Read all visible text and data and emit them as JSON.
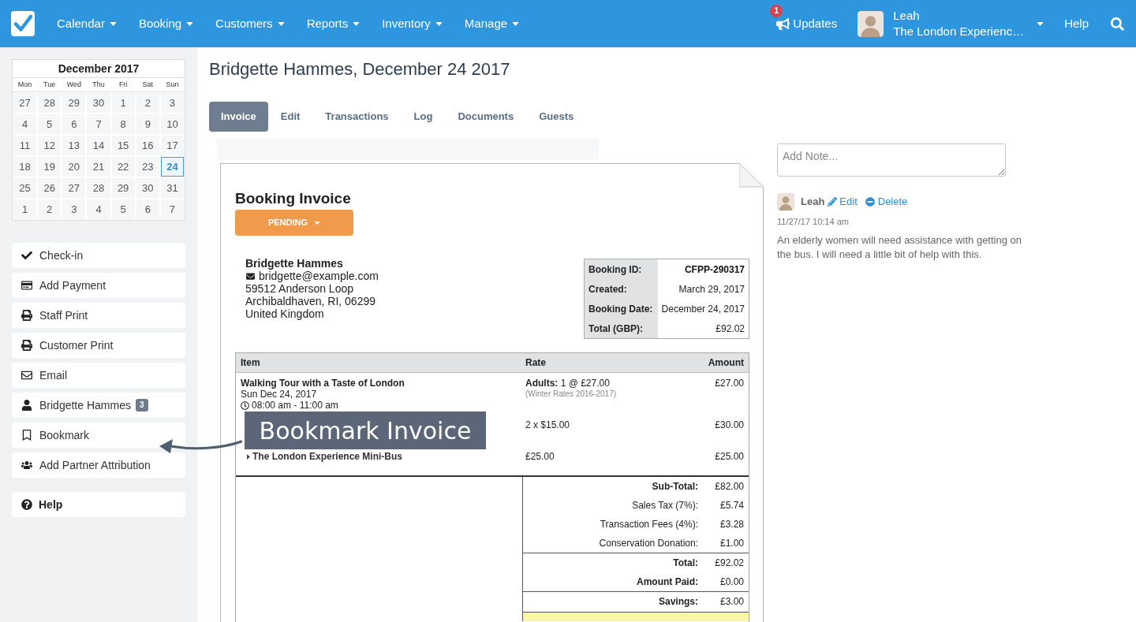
{
  "nav": {
    "items": [
      {
        "label": "Calendar"
      },
      {
        "label": "Booking"
      },
      {
        "label": "Customers"
      },
      {
        "label": "Reports"
      },
      {
        "label": "Inventory"
      },
      {
        "label": "Manage"
      }
    ],
    "updates": {
      "label": "Updates",
      "badge": "1"
    },
    "user": {
      "name": "Leah",
      "company": "The London Experienc…"
    },
    "help": "Help"
  },
  "sidebar": {
    "calendar": {
      "title": "December 2017",
      "weekdays": [
        "Mon",
        "Tue",
        "Wed",
        "Thu",
        "Fri",
        "Sat",
        "Sun"
      ],
      "weeks": [
        [
          {
            "day": "27",
            "selected": false
          },
          {
            "day": "28",
            "selected": false
          },
          {
            "day": "29",
            "selected": false
          },
          {
            "day": "30",
            "selected": false
          },
          {
            "day": "1",
            "selected": false
          },
          {
            "day": "2",
            "selected": false
          },
          {
            "day": "3",
            "selected": false
          }
        ],
        [
          {
            "day": "4",
            "selected": false
          },
          {
            "day": "5",
            "selected": false
          },
          {
            "day": "6",
            "selected": false
          },
          {
            "day": "7",
            "selected": false
          },
          {
            "day": "8",
            "selected": false
          },
          {
            "day": "9",
            "selected": false
          },
          {
            "day": "10",
            "selected": false
          }
        ],
        [
          {
            "day": "11",
            "selected": false
          },
          {
            "day": "12",
            "selected": false
          },
          {
            "day": "13",
            "selected": false
          },
          {
            "day": "14",
            "selected": false
          },
          {
            "day": "15",
            "selected": false
          },
          {
            "day": "16",
            "selected": false
          },
          {
            "day": "17",
            "selected": false
          }
        ],
        [
          {
            "day": "18",
            "selected": false
          },
          {
            "day": "19",
            "selected": false
          },
          {
            "day": "20",
            "selected": false
          },
          {
            "day": "21",
            "selected": false
          },
          {
            "day": "22",
            "selected": false
          },
          {
            "day": "23",
            "selected": false
          },
          {
            "day": "24",
            "selected": true
          }
        ],
        [
          {
            "day": "25",
            "selected": false
          },
          {
            "day": "26",
            "selected": false
          },
          {
            "day": "27",
            "selected": false
          },
          {
            "day": "28",
            "selected": false
          },
          {
            "day": "29",
            "selected": false
          },
          {
            "day": "30",
            "selected": false
          },
          {
            "day": "31",
            "selected": false
          }
        ],
        [
          {
            "day": "1",
            "selected": false
          },
          {
            "day": "2",
            "selected": false
          },
          {
            "day": "3",
            "selected": false
          },
          {
            "day": "4",
            "selected": false
          },
          {
            "day": "5",
            "selected": false
          },
          {
            "day": "6",
            "selected": false
          },
          {
            "day": "7",
            "selected": false
          }
        ]
      ]
    },
    "actions": [
      {
        "label": "Check-in"
      },
      {
        "label": "Add Payment"
      },
      {
        "label": "Staff Print"
      },
      {
        "label": "Customer Print"
      },
      {
        "label": "Email"
      },
      {
        "label": "Bridgette Hammes",
        "badge": "3"
      },
      {
        "label": "Bookmark"
      },
      {
        "label": "Add Partner Attribution"
      }
    ],
    "help": "Help"
  },
  "main": {
    "page_title": "Bridgette Hammes, December 24 2017",
    "tabs": [
      {
        "label": "Invoice",
        "selected": true
      },
      {
        "label": "Edit",
        "selected": false
      },
      {
        "label": "Transactions",
        "selected": false
      },
      {
        "label": "Log",
        "selected": false
      },
      {
        "label": "Documents",
        "selected": false
      },
      {
        "label": "Guests",
        "selected": false
      }
    ],
    "invoice": {
      "title": "Booking Invoice",
      "status": "PENDING",
      "customer": {
        "name": "Bridgette Hammes",
        "email": "bridgette@example.com",
        "address": [
          "59512 Anderson Loop",
          "Archibaldhaven, RI, 06299",
          "United Kingdom"
        ]
      },
      "details": [
        {
          "label": "Booking ID:",
          "value": "CFPP-290317",
          "kind": "id"
        },
        {
          "label": "Created:",
          "value": "March 29, 2017",
          "kind": "text"
        },
        {
          "label": "Booking Date:",
          "value": "December 24, 2017",
          "kind": "text"
        },
        {
          "label": "Total (GBP):",
          "value": "£92.02",
          "kind": "text"
        }
      ],
      "items": {
        "columns": [
          "Item",
          "Rate",
          "Amount"
        ],
        "rows": [
          {
            "kind": "tour",
            "name": "Walking Tour with a Taste of London",
            "date": "Sun Dec 24, 2017",
            "time": "08:00 am - 11:00 am",
            "rate": "**Adults:** 1 @ £27.00",
            "rate_note": "(Winter Rates 2016-2017)",
            "amount": "£27.00"
          },
          {
            "kind": "addon",
            "rate": "2 x $15.00",
            "amount": "£30.00"
          },
          {
            "kind": "addon",
            "name": "The London Experience Mini-Bus",
            "rate": "£25.00",
            "amount": "£25.00"
          }
        ]
      },
      "totals": [
        {
          "rows": [
            {
              "label": "Sub-Total:",
              "value": "£82.00",
              "kind": "main"
            },
            {
              "label": "Sales Tax (7%):",
              "value": "£5.74",
              "kind": "fee"
            },
            {
              "label": "Transaction Fees (4%):",
              "value": "£3.28",
              "kind": "fee"
            },
            {
              "label": "Conservation Donation:",
              "value": "£1.00",
              "kind": "fee"
            }
          ]
        },
        {
          "rows": [
            {
              "label": "Total:",
              "value": "£92.02",
              "kind": "main"
            },
            {
              "label": "Amount Paid:",
              "value": "£0.00",
              "kind": "main"
            }
          ]
        },
        {
          "rows": [
            {
              "label": "Savings:",
              "value": "£3.00",
              "kind": "main"
            }
          ]
        }
      ]
    }
  },
  "callout": {
    "text": "Bookmark Invoice"
  },
  "notes_panel": {
    "note_field": {
      "placeholder": "Add Note..."
    },
    "notes": [
      {
        "author": "Leah",
        "edit": "Edit",
        "delete": "Delete",
        "time": "11/27/17 10:14 am",
        "text": "An elderly women will need assistance with getting on the bus. I will need a little bit of help with this."
      }
    ]
  }
}
